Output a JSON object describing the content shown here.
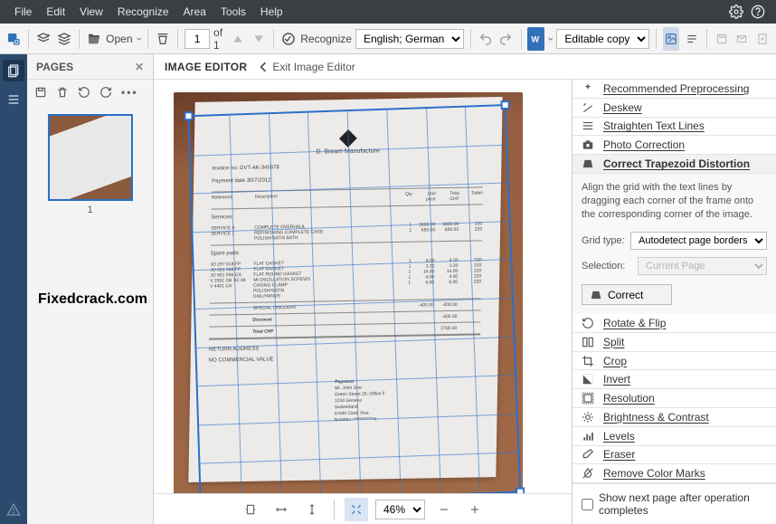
{
  "menu": {
    "items": [
      "File",
      "Edit",
      "View",
      "Recognize",
      "Area",
      "Tools",
      "Help"
    ]
  },
  "toolbar": {
    "open": "Open",
    "page_current": "1",
    "page_of": "of 1",
    "recognize": "Recognize",
    "language": "English; German",
    "editable": "Editable copy"
  },
  "pages": {
    "title": "PAGES",
    "thumb_label": "1"
  },
  "editor": {
    "title": "IMAGE EDITOR",
    "exit": "Exit Image Editor"
  },
  "doc": {
    "brand": "D. Bream Manufacture",
    "invoice": "Invoice no: DVT-AK-345678",
    "date": "Payment date 30/7/2012",
    "head": [
      "Reference",
      "Description",
      "Qty",
      "Unit price",
      "Total CHF",
      "Sales"
    ],
    "section1_title": "Services",
    "section1": [
      [
        "SERVICE 0",
        "COMPLETE OVERHAUL",
        "1",
        "3600.00",
        "3600.00",
        "220"
      ],
      [
        "SERVICE 1",
        "REFINISHING COMPLETE CASE",
        "1",
        "650.00",
        "650.00",
        "220"
      ],
      [
        "",
        "POLISH/SATIN BATH",
        "",
        "",
        "",
        ""
      ]
    ],
    "section2_title": "Spare parts",
    "section2": [
      [
        "JO 297 618 FP",
        "FLAT GASKET",
        "1",
        "8.00",
        "8.00",
        "220"
      ],
      [
        "JO 651 566 FP",
        "FLAT GASKET",
        "1",
        "3.20",
        "3.20",
        "220"
      ],
      [
        "JO 651 598 GS",
        "FLAT ROUND GASKET",
        "1",
        "14.00",
        "14.00",
        "220"
      ],
      [
        "V 2551 DB SC 94",
        "MI OSCILLATION SCREWS",
        "1",
        "4.00",
        "4.00",
        "220"
      ],
      [
        "V 4401 CA",
        "CASING CLAMP",
        "1",
        "6.00",
        "6.00",
        "220"
      ],
      [
        "",
        "POLISH/SATIN",
        "",
        "",
        "",
        ""
      ],
      [
        "",
        "DIAL/HANDS",
        "",
        "",
        "",
        ""
      ]
    ],
    "discount_label": "SPECIAL DISCOUNT",
    "discount_amt": "-400.00",
    "discount_tot": "-400.00",
    "discount_word": "Discount",
    "discount_val": "-400.00",
    "total_label": "Total CHF",
    "total_val": "2700.00",
    "footer1": "RETURN ADDRESS",
    "footer2": "NO COMMERCIAL VALUE",
    "pay_title": "Payment",
    "pay_lines": [
      "Mr. John Doe",
      "Green Street 15, Office F",
      "1234 Geneva",
      "Switzerland",
      "",
      "Credit Card: Visa",
      "Number: ************4"
    ]
  },
  "right": {
    "recommended": "Recommended Preprocessing",
    "deskew": "Deskew",
    "straighten": "Straighten Text Lines",
    "photo": "Photo Correction",
    "trapezoid": "Correct Trapezoid Distortion",
    "trapezoid_desc": "Align the grid with the text lines by dragging each corner of the frame onto the corresponding corner of the image.",
    "gridtype_label": "Grid type:",
    "gridtype_value": "Autodetect page borders",
    "selection_label": "Selection:",
    "selection_value": "Current Page",
    "correct_btn": "Correct",
    "rotate": "Rotate & Flip",
    "split": "Split",
    "crop": "Crop",
    "invert": "Invert",
    "resolution": "Resolution",
    "brightness": "Brightness & Contrast",
    "levels": "Levels",
    "eraser": "Eraser",
    "removecolor": "Remove Color Marks",
    "checkbox": "Show next page after operation completes",
    "zoom": "46%"
  },
  "watermark": "Fixedcrack.com"
}
